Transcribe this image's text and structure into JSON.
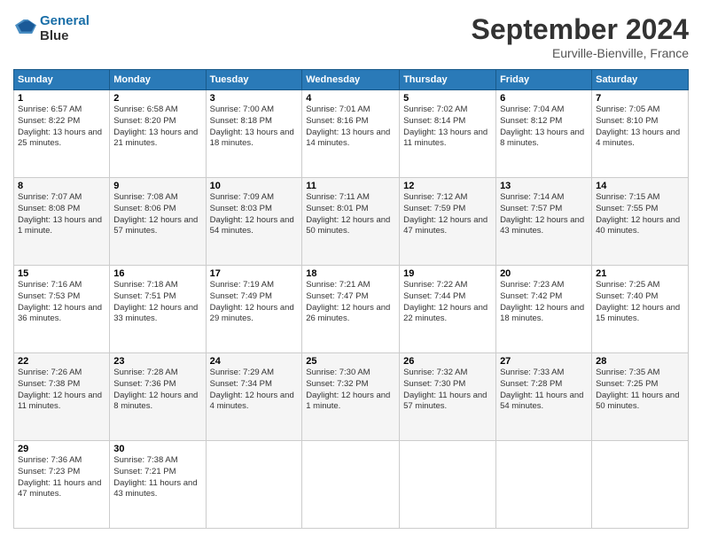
{
  "logo": {
    "line1": "General",
    "line2": "Blue"
  },
  "title": "September 2024",
  "location": "Eurville-Bienville, France",
  "headers": [
    "Sunday",
    "Monday",
    "Tuesday",
    "Wednesday",
    "Thursday",
    "Friday",
    "Saturday"
  ],
  "weeks": [
    [
      {
        "day": "1",
        "sunrise": "Sunrise: 6:57 AM",
        "sunset": "Sunset: 8:22 PM",
        "daylight": "Daylight: 13 hours and 25 minutes."
      },
      {
        "day": "2",
        "sunrise": "Sunrise: 6:58 AM",
        "sunset": "Sunset: 8:20 PM",
        "daylight": "Daylight: 13 hours and 21 minutes."
      },
      {
        "day": "3",
        "sunrise": "Sunrise: 7:00 AM",
        "sunset": "Sunset: 8:18 PM",
        "daylight": "Daylight: 13 hours and 18 minutes."
      },
      {
        "day": "4",
        "sunrise": "Sunrise: 7:01 AM",
        "sunset": "Sunset: 8:16 PM",
        "daylight": "Daylight: 13 hours and 14 minutes."
      },
      {
        "day": "5",
        "sunrise": "Sunrise: 7:02 AM",
        "sunset": "Sunset: 8:14 PM",
        "daylight": "Daylight: 13 hours and 11 minutes."
      },
      {
        "day": "6",
        "sunrise": "Sunrise: 7:04 AM",
        "sunset": "Sunset: 8:12 PM",
        "daylight": "Daylight: 13 hours and 8 minutes."
      },
      {
        "day": "7",
        "sunrise": "Sunrise: 7:05 AM",
        "sunset": "Sunset: 8:10 PM",
        "daylight": "Daylight: 13 hours and 4 minutes."
      }
    ],
    [
      {
        "day": "8",
        "sunrise": "Sunrise: 7:07 AM",
        "sunset": "Sunset: 8:08 PM",
        "daylight": "Daylight: 13 hours and 1 minute."
      },
      {
        "day": "9",
        "sunrise": "Sunrise: 7:08 AM",
        "sunset": "Sunset: 8:06 PM",
        "daylight": "Daylight: 12 hours and 57 minutes."
      },
      {
        "day": "10",
        "sunrise": "Sunrise: 7:09 AM",
        "sunset": "Sunset: 8:03 PM",
        "daylight": "Daylight: 12 hours and 54 minutes."
      },
      {
        "day": "11",
        "sunrise": "Sunrise: 7:11 AM",
        "sunset": "Sunset: 8:01 PM",
        "daylight": "Daylight: 12 hours and 50 minutes."
      },
      {
        "day": "12",
        "sunrise": "Sunrise: 7:12 AM",
        "sunset": "Sunset: 7:59 PM",
        "daylight": "Daylight: 12 hours and 47 minutes."
      },
      {
        "day": "13",
        "sunrise": "Sunrise: 7:14 AM",
        "sunset": "Sunset: 7:57 PM",
        "daylight": "Daylight: 12 hours and 43 minutes."
      },
      {
        "day": "14",
        "sunrise": "Sunrise: 7:15 AM",
        "sunset": "Sunset: 7:55 PM",
        "daylight": "Daylight: 12 hours and 40 minutes."
      }
    ],
    [
      {
        "day": "15",
        "sunrise": "Sunrise: 7:16 AM",
        "sunset": "Sunset: 7:53 PM",
        "daylight": "Daylight: 12 hours and 36 minutes."
      },
      {
        "day": "16",
        "sunrise": "Sunrise: 7:18 AM",
        "sunset": "Sunset: 7:51 PM",
        "daylight": "Daylight: 12 hours and 33 minutes."
      },
      {
        "day": "17",
        "sunrise": "Sunrise: 7:19 AM",
        "sunset": "Sunset: 7:49 PM",
        "daylight": "Daylight: 12 hours and 29 minutes."
      },
      {
        "day": "18",
        "sunrise": "Sunrise: 7:21 AM",
        "sunset": "Sunset: 7:47 PM",
        "daylight": "Daylight: 12 hours and 26 minutes."
      },
      {
        "day": "19",
        "sunrise": "Sunrise: 7:22 AM",
        "sunset": "Sunset: 7:44 PM",
        "daylight": "Daylight: 12 hours and 22 minutes."
      },
      {
        "day": "20",
        "sunrise": "Sunrise: 7:23 AM",
        "sunset": "Sunset: 7:42 PM",
        "daylight": "Daylight: 12 hours and 18 minutes."
      },
      {
        "day": "21",
        "sunrise": "Sunrise: 7:25 AM",
        "sunset": "Sunset: 7:40 PM",
        "daylight": "Daylight: 12 hours and 15 minutes."
      }
    ],
    [
      {
        "day": "22",
        "sunrise": "Sunrise: 7:26 AM",
        "sunset": "Sunset: 7:38 PM",
        "daylight": "Daylight: 12 hours and 11 minutes."
      },
      {
        "day": "23",
        "sunrise": "Sunrise: 7:28 AM",
        "sunset": "Sunset: 7:36 PM",
        "daylight": "Daylight: 12 hours and 8 minutes."
      },
      {
        "day": "24",
        "sunrise": "Sunrise: 7:29 AM",
        "sunset": "Sunset: 7:34 PM",
        "daylight": "Daylight: 12 hours and 4 minutes."
      },
      {
        "day": "25",
        "sunrise": "Sunrise: 7:30 AM",
        "sunset": "Sunset: 7:32 PM",
        "daylight": "Daylight: 12 hours and 1 minute."
      },
      {
        "day": "26",
        "sunrise": "Sunrise: 7:32 AM",
        "sunset": "Sunset: 7:30 PM",
        "daylight": "Daylight: 11 hours and 57 minutes."
      },
      {
        "day": "27",
        "sunrise": "Sunrise: 7:33 AM",
        "sunset": "Sunset: 7:28 PM",
        "daylight": "Daylight: 11 hours and 54 minutes."
      },
      {
        "day": "28",
        "sunrise": "Sunrise: 7:35 AM",
        "sunset": "Sunset: 7:25 PM",
        "daylight": "Daylight: 11 hours and 50 minutes."
      }
    ],
    [
      {
        "day": "29",
        "sunrise": "Sunrise: 7:36 AM",
        "sunset": "Sunset: 7:23 PM",
        "daylight": "Daylight: 11 hours and 47 minutes."
      },
      {
        "day": "30",
        "sunrise": "Sunrise: 7:38 AM",
        "sunset": "Sunset: 7:21 PM",
        "daylight": "Daylight: 11 hours and 43 minutes."
      },
      null,
      null,
      null,
      null,
      null
    ]
  ]
}
